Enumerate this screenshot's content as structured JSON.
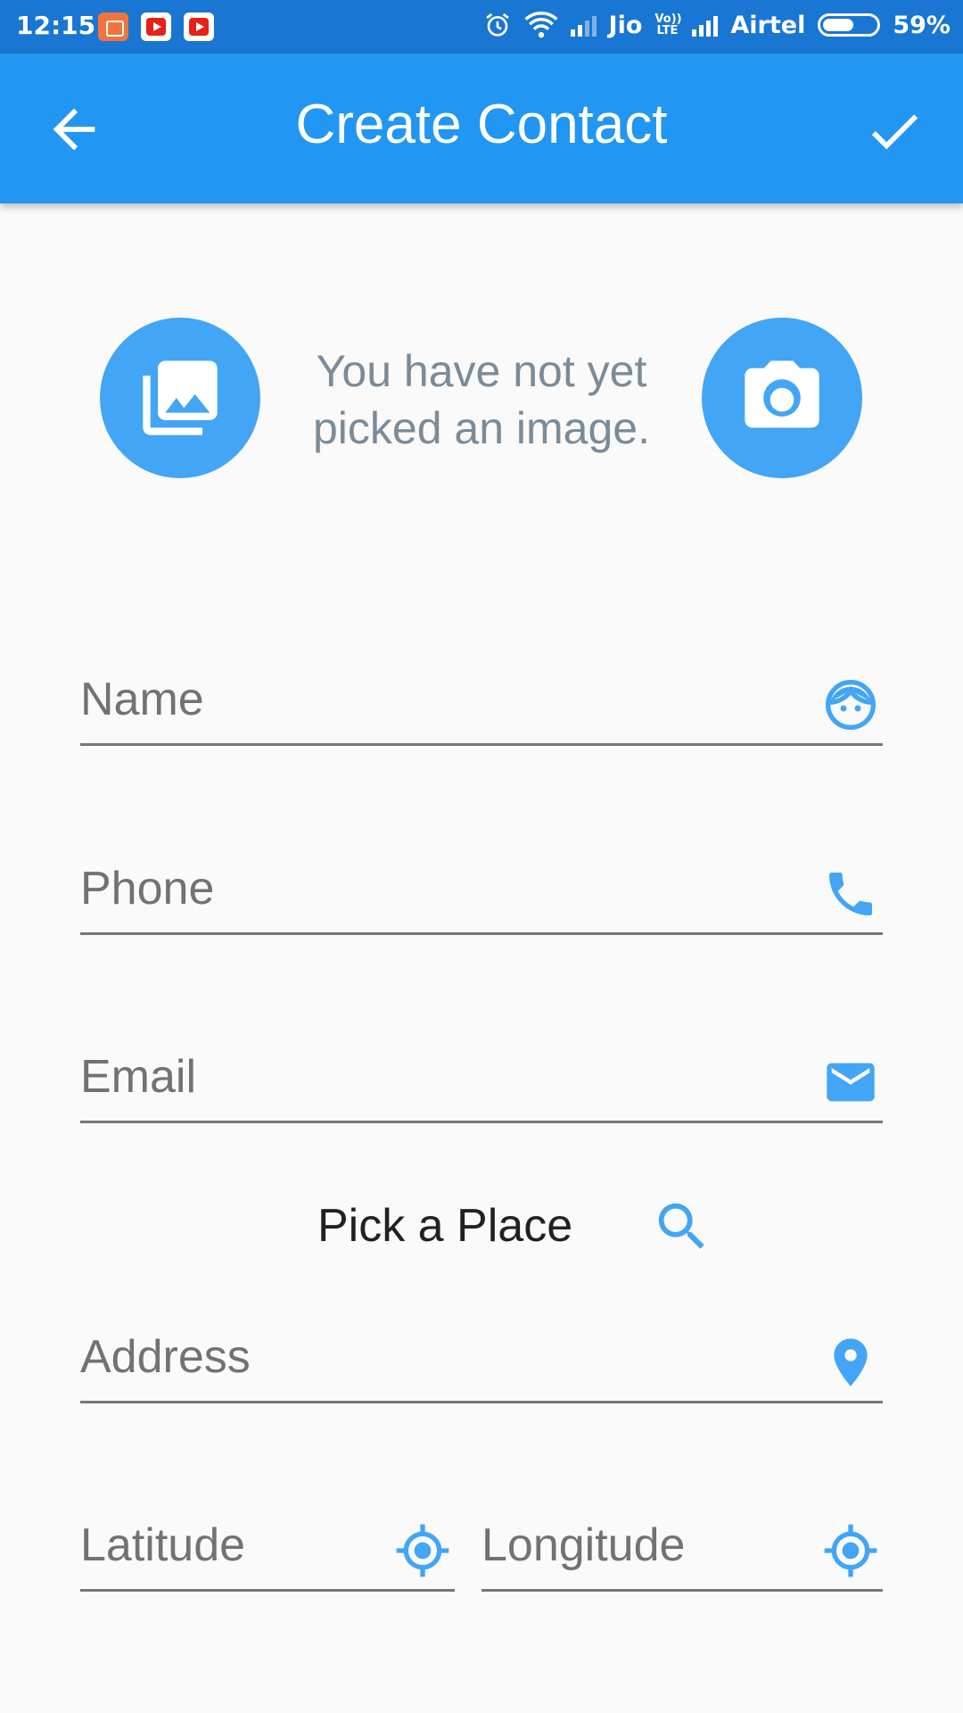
{
  "status_bar": {
    "time": "12:15",
    "carrier1": "Jio",
    "volte": "Vo)) LTE",
    "carrier2": "Airtel",
    "battery": "59%",
    "battery_level": 0.59
  },
  "app_bar": {
    "title": "Create Contact",
    "back_icon": "arrow-back-icon",
    "confirm_icon": "check-icon",
    "color": "#2196f3"
  },
  "image_picker": {
    "message": "You have not yet picked an image.",
    "gallery_icon": "photo-library-icon",
    "camera_icon": "camera-icon",
    "accent": "#42a5f5"
  },
  "form": {
    "name": {
      "label": "Name",
      "icon": "face-icon"
    },
    "phone": {
      "label": "Phone",
      "icon": "phone-icon"
    },
    "email": {
      "label": "Email",
      "icon": "mail-icon"
    },
    "pick_place": {
      "label": "Pick a Place",
      "icon": "search-icon"
    },
    "address": {
      "label": "Address",
      "icon": "location-pin-icon"
    },
    "latitude": {
      "label": "Latitude",
      "icon": "gps-fixed-icon"
    },
    "longitude": {
      "label": "Longitude",
      "icon": "gps-fixed-icon"
    }
  }
}
